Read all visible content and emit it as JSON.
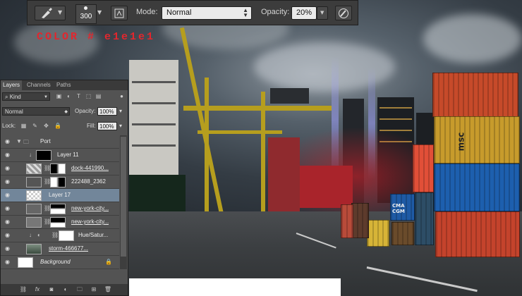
{
  "options_bar": {
    "brush_size": "300",
    "mode_label": "Mode:",
    "mode_value": "Normal",
    "opacity_label": "Opacity:",
    "opacity_value": "20%"
  },
  "overlay": {
    "color_text": "COLOR # e1e1e1"
  },
  "layers_panel": {
    "tabs": [
      "Layers",
      "Channels",
      "Paths"
    ],
    "kind_filter": "Kind",
    "blend_mode": "Normal",
    "opacity_label": "Opacity:",
    "opacity_value": "100%",
    "lock_label": "Lock:",
    "fill_label": "Fill:",
    "fill_value": "100%",
    "layers": [
      {
        "name": "Port"
      },
      {
        "name": "Layer 11"
      },
      {
        "name": "dock-441990..."
      },
      {
        "name": "222488_2362"
      },
      {
        "name": "Layer 17"
      },
      {
        "name": "new-york-city..."
      },
      {
        "name": "new-york-city..."
      },
      {
        "name": "Hue/Satur..."
      },
      {
        "name": "storm-466677..."
      },
      {
        "name": "Background"
      }
    ]
  },
  "containers": {
    "msc": "msc",
    "cma": "CMA CGM"
  },
  "colors": {
    "panel_bg": "#535353",
    "selected_layer": "#72869a",
    "accent_red": "#e3262d"
  }
}
